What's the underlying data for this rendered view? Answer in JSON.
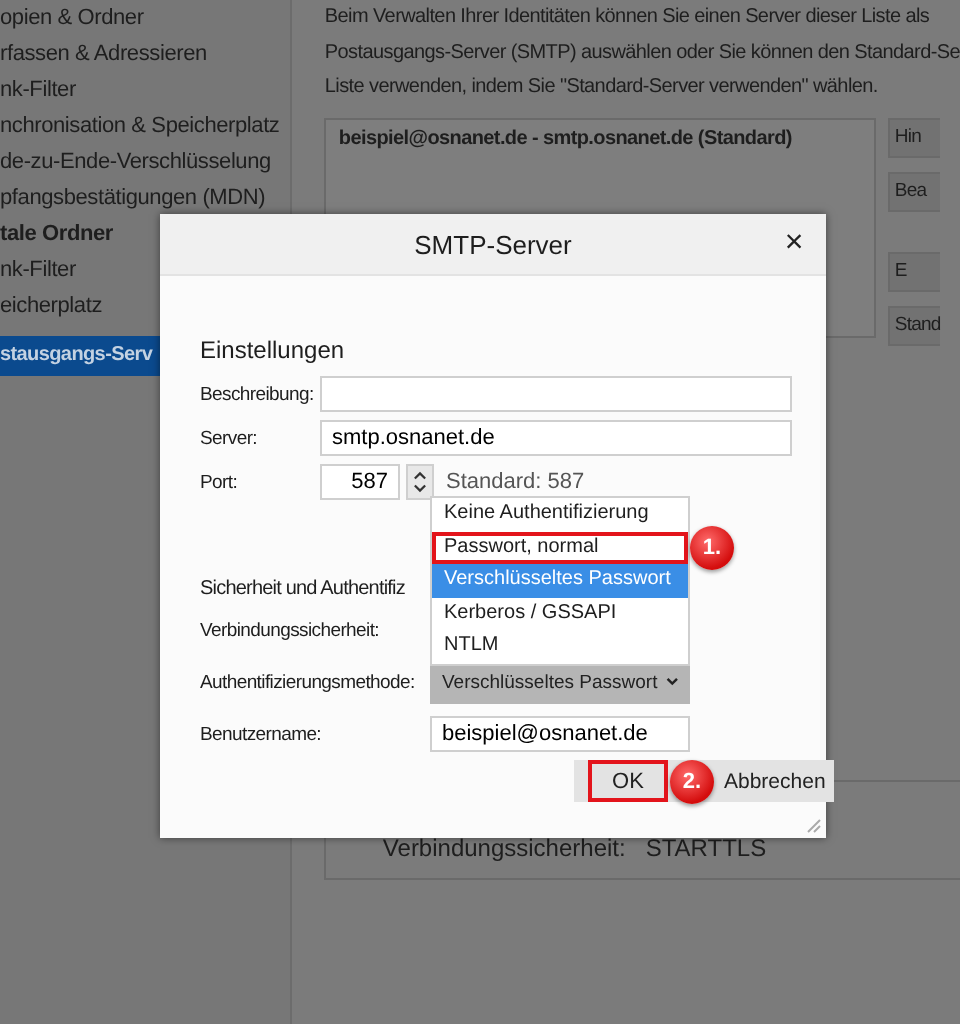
{
  "sidebar": {
    "items": [
      {
        "label": "opien & Ordner",
        "bold": false,
        "selected": false
      },
      {
        "label": "rfassen & Adressieren",
        "bold": false,
        "selected": false
      },
      {
        "label": "nk-Filter",
        "bold": false,
        "selected": false
      },
      {
        "label": "nchronisation & Speicherplatz",
        "bold": false,
        "selected": false
      },
      {
        "label": "de-zu-Ende-Verschlüsselung",
        "bold": false,
        "selected": false
      },
      {
        "label": "pfangsbestätigungen (MDN)",
        "bold": false,
        "selected": false
      },
      {
        "label": "tale Ordner",
        "bold": true,
        "selected": false
      },
      {
        "label": "nk-Filter",
        "bold": false,
        "selected": false
      },
      {
        "label": "eicherplatz",
        "bold": false,
        "selected": false
      },
      {
        "label": "stausgangs-Serv",
        "bold": false,
        "selected": true
      }
    ]
  },
  "description": [
    "Beim Verwalten Ihrer Identitäten können Sie einen Server dieser Liste als",
    "Postausgangs-Server (SMTP) auswählen oder Sie können den Standard-Se",
    "Liste verwenden, indem Sie \"Standard-Server verwenden\" wählen."
  ],
  "server_list": {
    "rows": [
      "beispiel@osnanet.de - smtp.osnanet.de (Standard)"
    ]
  },
  "side_buttons": [
    "Hin",
    "Bea",
    "E",
    "Stand"
  ],
  "details": {
    "label": "Verbindungssicherheit:",
    "value": "STARTTLS"
  },
  "dialog": {
    "title": "SMTP-Server",
    "close": "×",
    "settings": {
      "heading": "Einstellungen",
      "fields": [
        {
          "kind": "text",
          "label": "Beschreibung:"
        },
        {
          "kind": "text",
          "label": "Server:",
          "value": "smtp.osnanet.de"
        },
        {
          "kind": "port",
          "label": "Port:",
          "value": "587",
          "hint": "Standard: 587"
        }
      ]
    },
    "security": {
      "heading": "Sicherheit und Authentifiz",
      "fields": [
        {
          "kind": "covered",
          "label": "Verbindungssicherheit:"
        },
        {
          "kind": "select",
          "label": "Authentifizierungsmethode:",
          "value": "Verschlüsseltes Passwort"
        },
        {
          "kind": "text",
          "label": "Benutzername:",
          "value": "beispiel@osnanet.de"
        }
      ]
    },
    "dropdown": {
      "options": [
        {
          "label": "Keine Authentifizierung",
          "selected": false
        },
        {
          "label": "Passwort, normal",
          "selected": false,
          "callout": "1."
        },
        {
          "label": "Verschlüsseltes Passwort",
          "selected": true
        },
        {
          "label": "Kerberos / GSSAPI",
          "selected": false
        },
        {
          "label": "NTLM",
          "selected": false
        }
      ]
    },
    "buttons": [
      {
        "label": "OK",
        "callout": "2."
      },
      {
        "label": "Abbrechen"
      }
    ]
  }
}
